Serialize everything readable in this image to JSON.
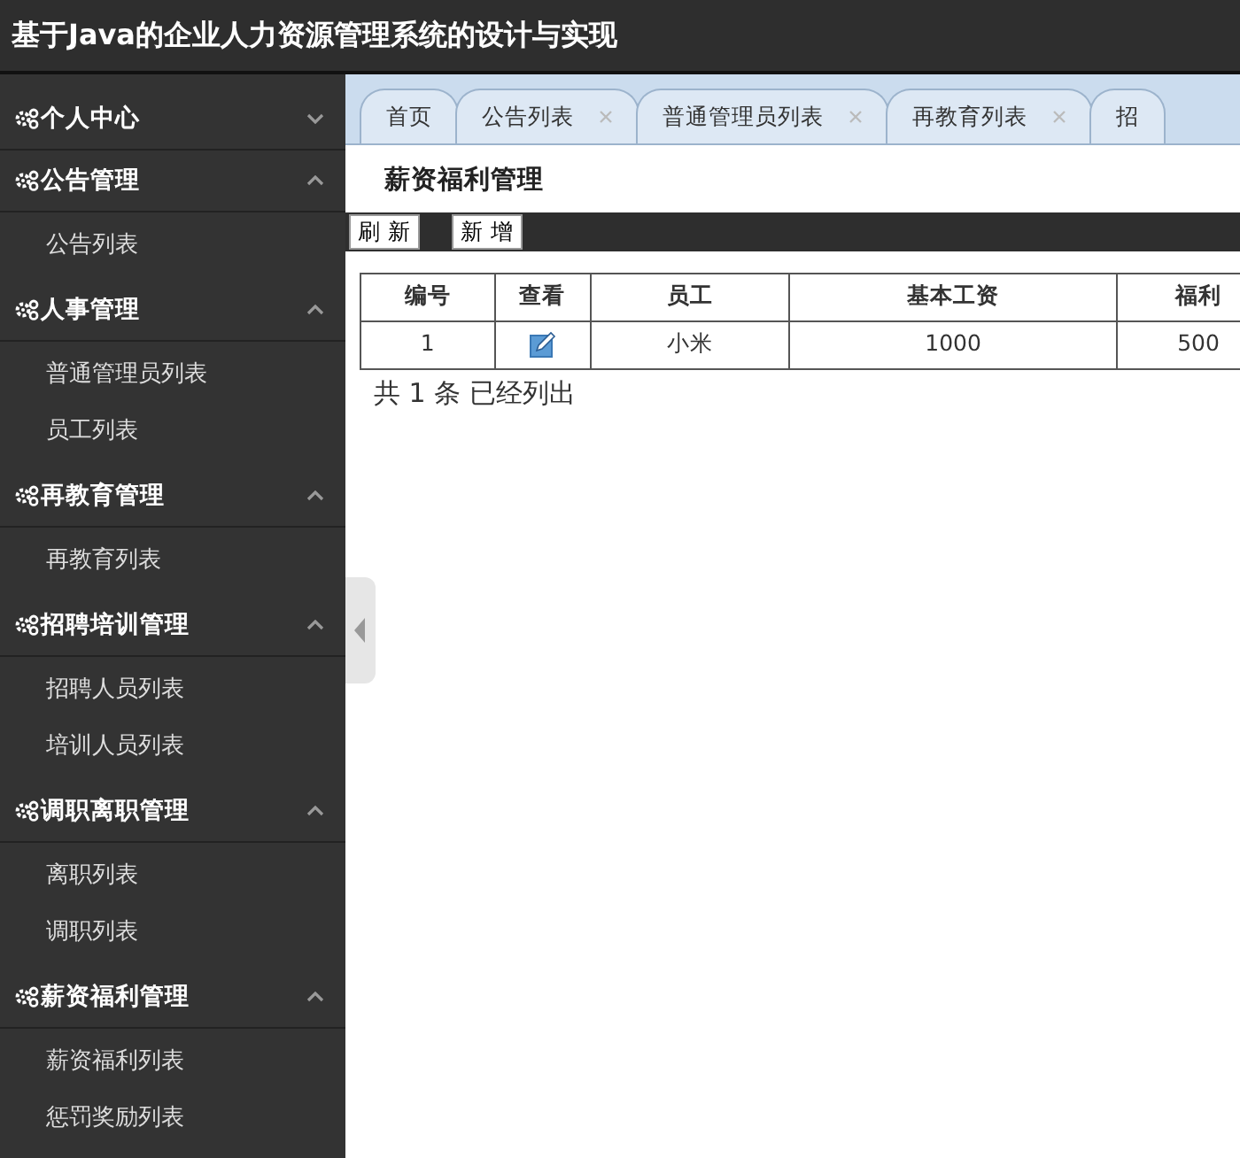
{
  "header": {
    "title": "基于Java的企业人力资源管理系统的设计与实现"
  },
  "sidebar": {
    "groups": [
      {
        "label": "个人中心",
        "expanded": false
      },
      {
        "label": "公告管理",
        "expanded": true,
        "items": [
          {
            "label": "公告列表"
          }
        ]
      },
      {
        "label": "人事管理",
        "expanded": true,
        "items": [
          {
            "label": "普通管理员列表"
          },
          {
            "label": "员工列表"
          }
        ]
      },
      {
        "label": "再教育管理",
        "expanded": true,
        "items": [
          {
            "label": "再教育列表"
          }
        ]
      },
      {
        "label": "招聘培训管理",
        "expanded": true,
        "items": [
          {
            "label": "招聘人员列表"
          },
          {
            "label": "培训人员列表"
          }
        ]
      },
      {
        "label": "调职离职管理",
        "expanded": true,
        "items": [
          {
            "label": "离职列表"
          },
          {
            "label": "调职列表"
          }
        ]
      },
      {
        "label": "薪资福利管理",
        "expanded": true,
        "items": [
          {
            "label": "薪资福利列表"
          },
          {
            "label": "惩罚奖励列表"
          }
        ]
      }
    ]
  },
  "tabs": [
    {
      "label": "首页",
      "closable": false
    },
    {
      "label": "公告列表",
      "closable": true
    },
    {
      "label": "普通管理员列表",
      "closable": true
    },
    {
      "label": "再教育列表",
      "closable": true
    },
    {
      "label": "招",
      "closable": false
    }
  ],
  "page_title": "薪资福利管理",
  "toolbar": [
    "刷 新",
    "新 增"
  ],
  "table": {
    "columns": [
      "编号",
      "查看",
      "员工",
      "基本工资",
      "福利"
    ],
    "rows": [
      [
        "1",
        "",
        "小米",
        "1000",
        "500"
      ]
    ]
  },
  "footer": "共 1 条 已经列出"
}
